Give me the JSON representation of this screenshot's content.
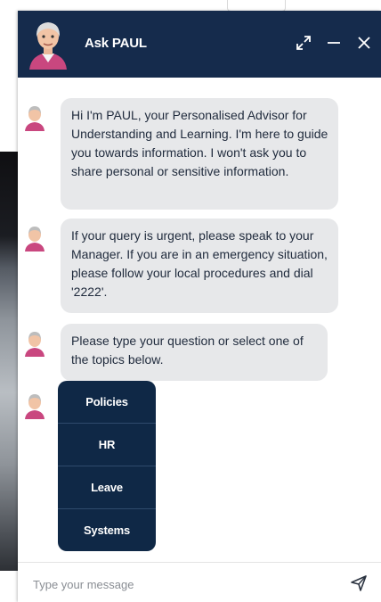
{
  "header": {
    "title": "Ask PAUL",
    "icons": [
      "expand-icon",
      "minimize-icon",
      "close-icon"
    ]
  },
  "messages": [
    {
      "text": "Hi I'm PAUL, your Personalised Advisor for Understanding and Learning. I'm here to guide you towards information. I won't ask you to share personal or sensitive information."
    },
    {
      "text": "If your query is urgent, please speak to your Manager. If you are in an emergency situation, please follow your local procedures and dial '2222'."
    },
    {
      "text": "Please type your question or select one of the topics below."
    }
  ],
  "topics": [
    "Policies",
    "HR",
    "Leave",
    "Systems"
  ],
  "composer": {
    "placeholder": "Type your message",
    "send_icon": "send-icon"
  },
  "colors": {
    "header_bg": "#152b4c",
    "bubble_bg": "#e7e8ea",
    "topic_bg": "#0f2846"
  }
}
